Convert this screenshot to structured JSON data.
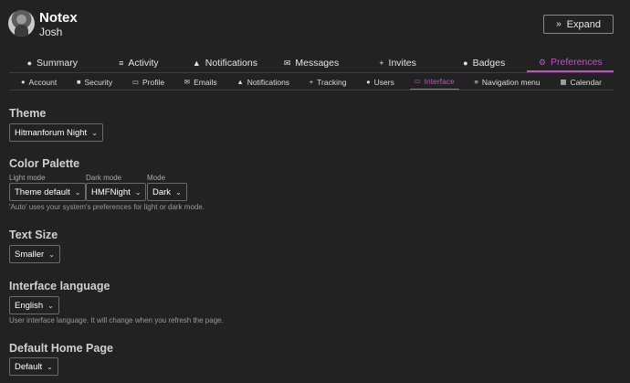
{
  "header": {
    "title": "Notex",
    "username": "Josh",
    "expand_label": "Expand",
    "expand_icon": "chevrons-down-icon"
  },
  "main_nav": {
    "tabs": [
      {
        "label": "Summary",
        "icon": "user-icon",
        "active": false
      },
      {
        "label": "Activity",
        "icon": "list-icon",
        "active": false
      },
      {
        "label": "Notifications",
        "icon": "bell-icon",
        "active": false
      },
      {
        "label": "Messages",
        "icon": "envelope-icon",
        "active": false
      },
      {
        "label": "Invites",
        "icon": "user-plus-icon",
        "active": false
      },
      {
        "label": "Badges",
        "icon": "badge-icon",
        "active": false
      },
      {
        "label": "Preferences",
        "icon": "gear-icon",
        "active": true
      }
    ],
    "active_color": "#c251c6"
  },
  "sub_nav": {
    "tabs": [
      {
        "label": "Account",
        "icon": "user-icon",
        "active": false
      },
      {
        "label": "Security",
        "icon": "lock-icon",
        "active": false
      },
      {
        "label": "Profile",
        "icon": "id-card-icon",
        "active": false
      },
      {
        "label": "Emails",
        "icon": "envelope-icon",
        "active": false
      },
      {
        "label": "Notifications",
        "icon": "bell-icon",
        "active": false
      },
      {
        "label": "Tracking",
        "icon": "plus-icon",
        "active": false
      },
      {
        "label": "Users",
        "icon": "users-icon",
        "active": false
      },
      {
        "label": "Interface",
        "icon": "desktop-icon",
        "active": true
      },
      {
        "label": "Navigation menu",
        "icon": "bars-icon",
        "active": false
      },
      {
        "label": "Calendar",
        "icon": "calendar-icon",
        "active": false
      }
    ]
  },
  "theme": {
    "title": "Theme",
    "value": "Hitmanforum Night"
  },
  "color_palette": {
    "title": "Color Palette",
    "light_label": "Light mode",
    "light_value": "Theme default",
    "dark_label": "Dark mode",
    "dark_value": "HMFNight",
    "mode_label": "Mode",
    "mode_value": "Dark",
    "helper": "'Auto' uses your system's preferences for light or dark mode."
  },
  "text_size": {
    "title": "Text Size",
    "value": "Smaller"
  },
  "interface_language": {
    "title": "Interface language",
    "value": "English",
    "helper": "User interface language. It will change when you refresh the page."
  },
  "default_home_page": {
    "title": "Default Home Page",
    "value": "Default"
  }
}
